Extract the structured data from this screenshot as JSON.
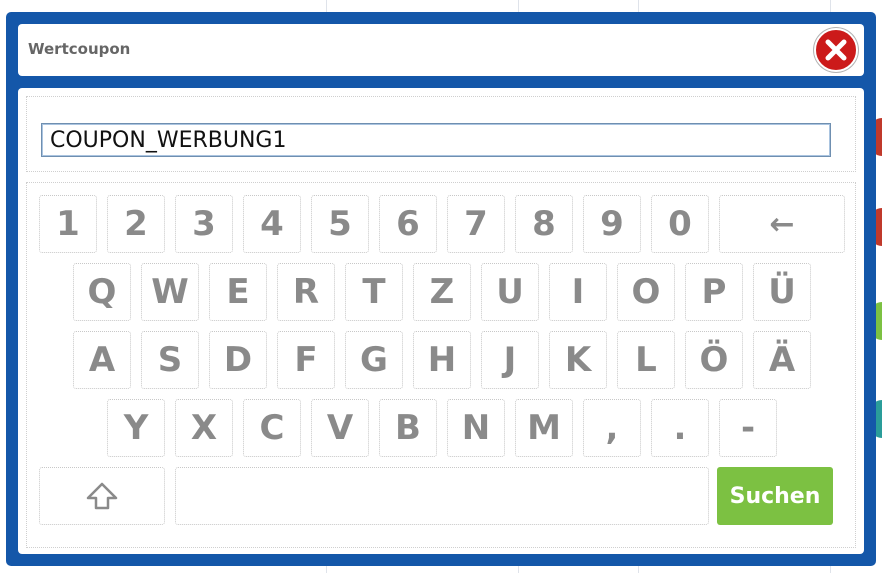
{
  "dialog": {
    "title": "Wertcoupon",
    "close_icon": "close-x-icon"
  },
  "coupon_input": {
    "value": "COUPON_WERBUNG1",
    "placeholder": ""
  },
  "keyboard": {
    "row1": [
      "1",
      "2",
      "3",
      "4",
      "5",
      "6",
      "7",
      "8",
      "9",
      "0"
    ],
    "backspace_label": "←",
    "row2": [
      "Q",
      "W",
      "E",
      "R",
      "T",
      "Z",
      "U",
      "I",
      "O",
      "P",
      "Ü"
    ],
    "row3": [
      "A",
      "S",
      "D",
      "F",
      "G",
      "H",
      "J",
      "K",
      "L",
      "Ö",
      "Ä"
    ],
    "row4": [
      "Y",
      "X",
      "C",
      "V",
      "B",
      "N",
      "M",
      ",",
      ".",
      "-"
    ],
    "shift_icon": "shift-arrow-icon",
    "search_label": "Suchen"
  },
  "colors": {
    "frame": "#1457a9",
    "close": "#cc1a1a",
    "search_button": "#7cc142",
    "key_text": "#8a8a8a"
  }
}
